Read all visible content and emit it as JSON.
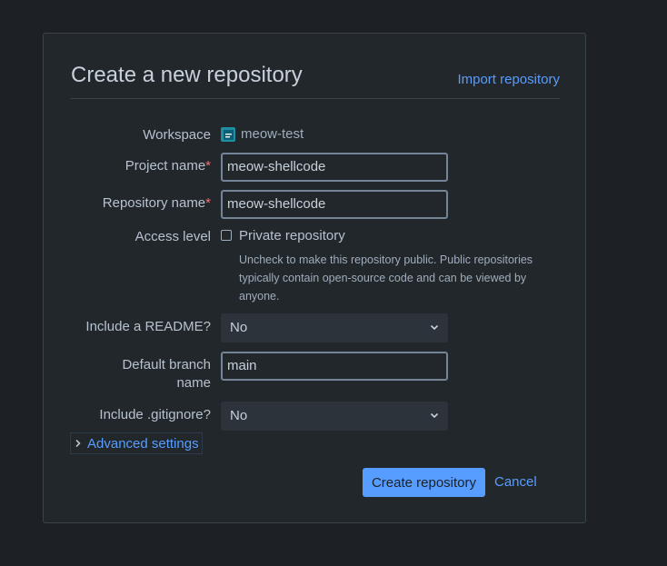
{
  "header": {
    "title": "Create a new repository",
    "import_link": "Import repository"
  },
  "form": {
    "workspace": {
      "label": "Workspace",
      "value": "meow-test",
      "icon": "workspace-avatar-icon"
    },
    "project_name": {
      "label": "Project name",
      "required_marker": "*",
      "value": "meow-shellcode"
    },
    "repository_name": {
      "label": "Repository name",
      "required_marker": "*",
      "value": "meow-shellcode"
    },
    "access_level": {
      "label": "Access level",
      "checkbox_label": "Private repository",
      "checked": false,
      "help": "Uncheck to make this repository public. Public repositories typically contain open-source code and can be viewed by anyone."
    },
    "readme": {
      "label": "Include a README?",
      "selected": "No"
    },
    "default_branch": {
      "label_line1": "Default branch",
      "label_line2": "name",
      "value": "main"
    },
    "gitignore": {
      "label": "Include .gitignore?",
      "selected": "No"
    },
    "advanced": {
      "label": "Advanced settings"
    }
  },
  "actions": {
    "create": "Create repository",
    "cancel": "Cancel"
  },
  "colors": {
    "background": "#1d2125",
    "card": "#22272b",
    "link": "#579dff",
    "required": "#f87168"
  }
}
